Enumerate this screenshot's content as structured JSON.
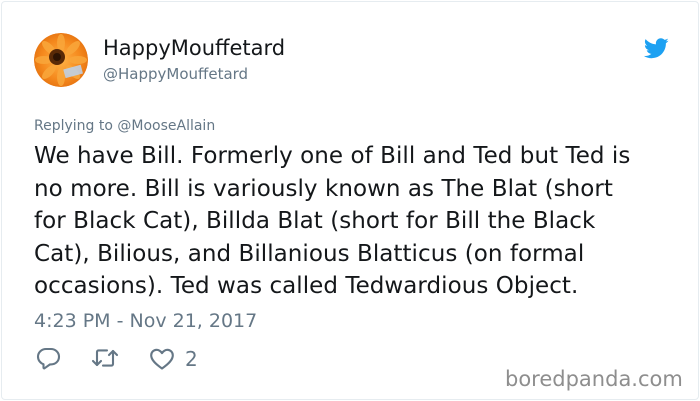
{
  "user": {
    "display_name": "HappyMouffetard",
    "handle": "@HappyMouffetard",
    "avatar_icon": "orange-flower-avatar"
  },
  "brand": {
    "icon": "twitter-bird-icon",
    "color": "#1da1f2"
  },
  "tweet": {
    "replying_to": "Replying to @MooseAllain",
    "lines": [
      "We have Bill. Formerly one of Bill and Ted but Ted is",
      "no more. Bill is variously known as The Blat (short",
      "for Black Cat), Billda Blat (short for Bill the Black",
      "Cat), Bilious, and Billanious Blatticus (on formal",
      "occasions). Ted was called Tedwardious Object."
    ],
    "timestamp": "4:23 PM - Nov 21, 2017"
  },
  "actions": {
    "reply_icon": "reply-icon",
    "retweet_icon": "retweet-icon",
    "like_icon": "heart-icon",
    "like_count": "2"
  },
  "watermark": "boredpanda.com",
  "colors": {
    "text": "#14171a",
    "secondary": "#657786",
    "border": "#e6ecf0",
    "watermark": "#8e8e8e"
  }
}
